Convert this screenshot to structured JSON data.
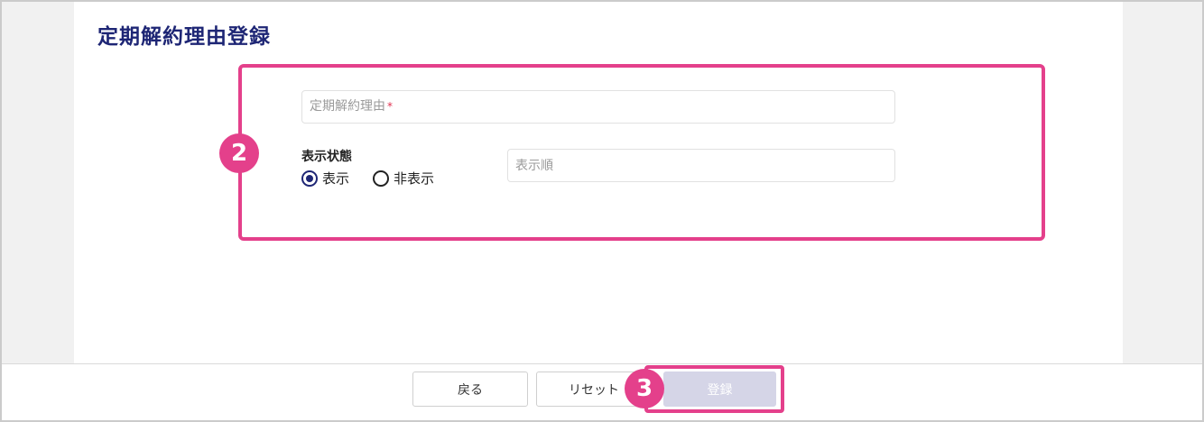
{
  "page": {
    "title": "定期解約理由登録"
  },
  "form": {
    "reason_field": {
      "placeholder": "定期解約理由",
      "required_mark": "*"
    },
    "display_status": {
      "label": "表示状態",
      "options": [
        {
          "label": "表示",
          "selected": true
        },
        {
          "label": "非表示",
          "selected": false
        }
      ]
    },
    "order_field": {
      "placeholder": "表示順"
    }
  },
  "footer": {
    "back_label": "戻る",
    "reset_label": "リセット",
    "submit_label": "登録",
    "submit_disabled": true
  },
  "annotations": {
    "form_badge": "2",
    "submit_badge": "3"
  },
  "colors": {
    "title": "#1e2675",
    "radio_selected": "#1e2675",
    "annotation": "#e4408b",
    "required": "#e0304f",
    "submit_disabled_bg": "#d5d5e7"
  }
}
